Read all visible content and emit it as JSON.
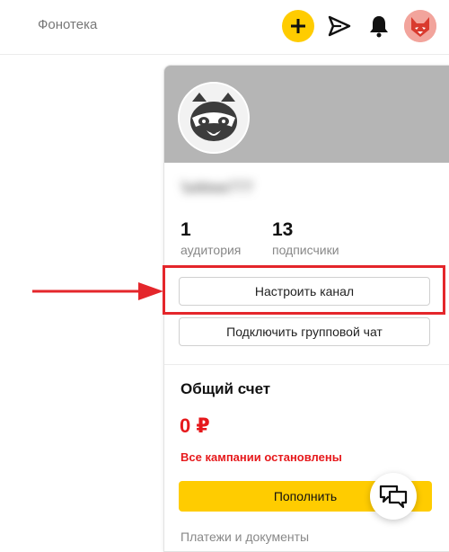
{
  "header": {
    "nav_link": "Фонотека",
    "icons": [
      "plus-icon",
      "send-icon",
      "bell-icon",
      "user-avatar"
    ],
    "accent_color": "#ffcc00"
  },
  "channel": {
    "name": "Ъёёюк777",
    "stats": [
      {
        "value": "1",
        "label": "аудитория"
      },
      {
        "value": "13",
        "label": "подписчики"
      }
    ],
    "setup_button": "Настроить канал",
    "group_chat_button": "Подключить групповой чат"
  },
  "account": {
    "title": "Общий счет",
    "balance": "0 ₽",
    "status": "Все кампании остановлены",
    "topup_button": "Пополнить",
    "payments_link": "Платежи и документы",
    "status_color": "#e6191c"
  },
  "annotation": {
    "highlight_color": "#e4262b"
  }
}
